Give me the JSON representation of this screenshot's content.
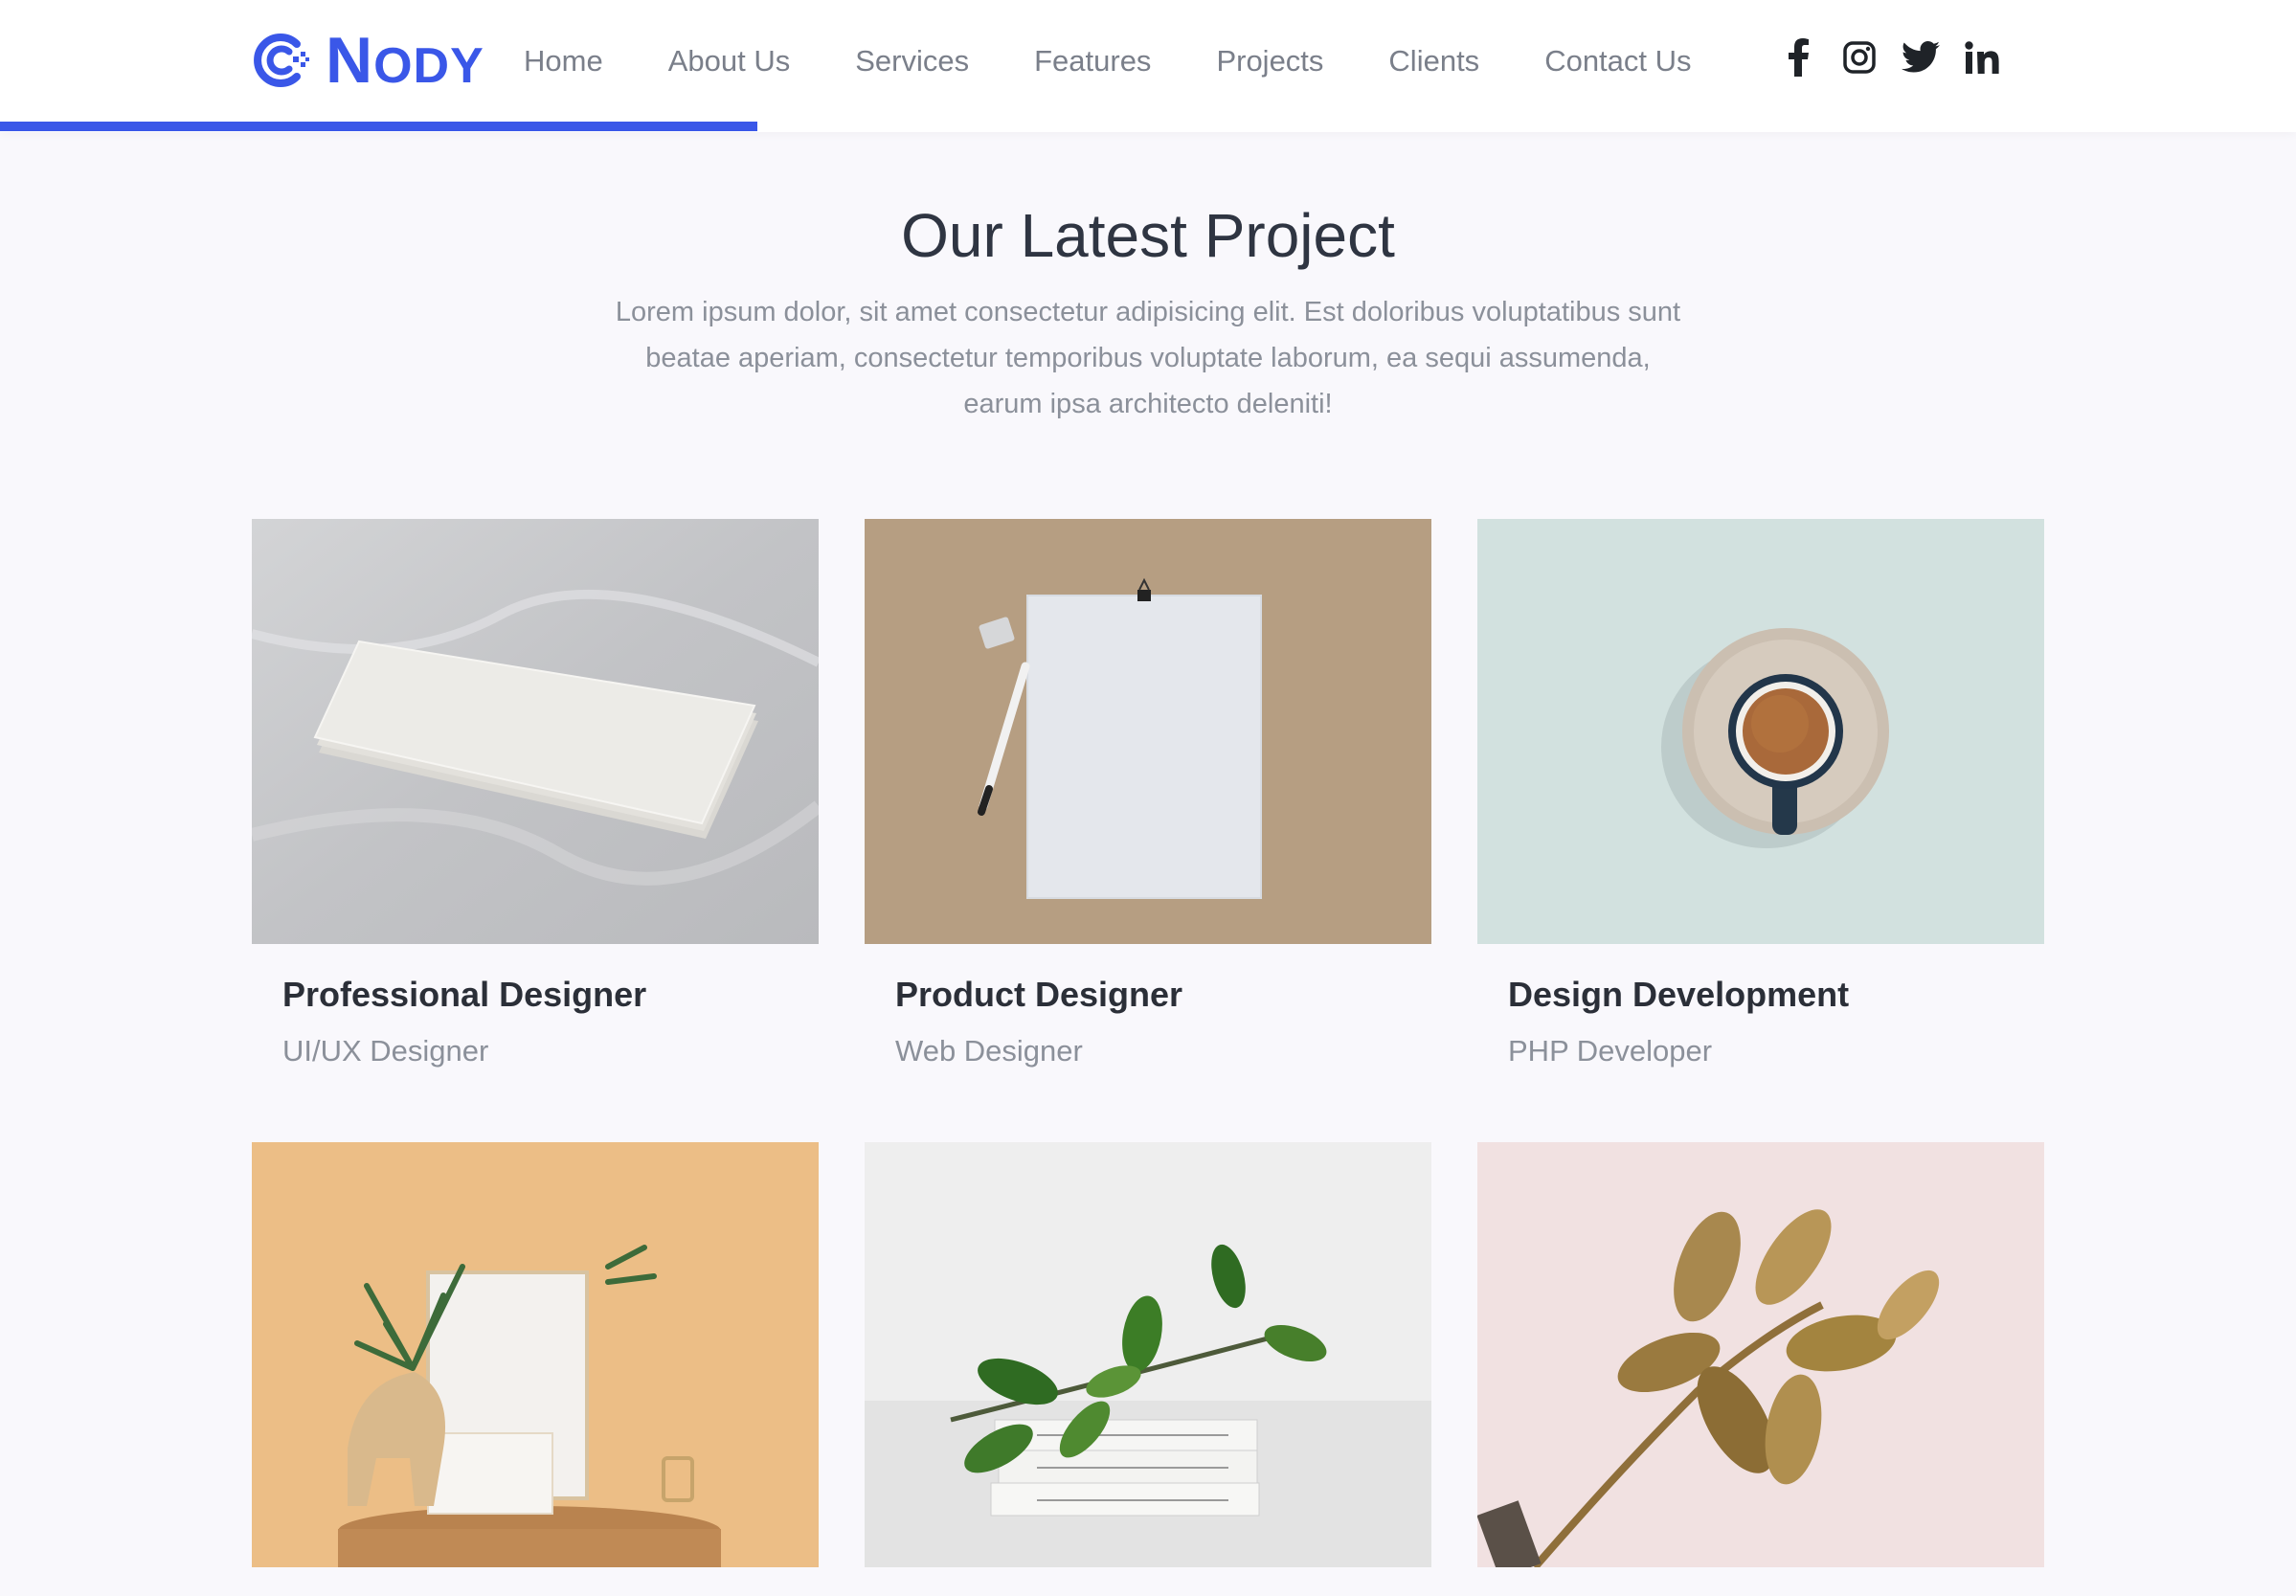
{
  "brand": {
    "logo_first": "N",
    "logo_rest": "ODY",
    "color": "#3a57e8"
  },
  "nav": [
    {
      "label": "Home"
    },
    {
      "label": "About Us"
    },
    {
      "label": "Services"
    },
    {
      "label": "Features"
    },
    {
      "label": "Projects"
    },
    {
      "label": "Clients"
    },
    {
      "label": "Contact Us"
    }
  ],
  "social": [
    "facebook-icon",
    "instagram-icon",
    "twitter-icon",
    "linkedin-icon"
  ],
  "scroll_progress": 0.33,
  "section": {
    "title": "Our Latest Project",
    "lead": "Lorem ipsum dolor, sit amet consectetur adipisicing elit. Est doloribus voluptatibus sunt beatae aperiam, consectetur temporibus voluptate laborum, ea sequi assumenda, earum ipsa architecto deleniti!"
  },
  "projects": [
    {
      "name": "Professional Designer",
      "role": "UI/UX Designer"
    },
    {
      "name": "Product Designer",
      "role": "Web Designer"
    },
    {
      "name": "Design Development",
      "role": "PHP Developer"
    },
    {
      "name": "",
      "role": ""
    },
    {
      "name": "",
      "role": ""
    },
    {
      "name": "",
      "role": ""
    }
  ]
}
